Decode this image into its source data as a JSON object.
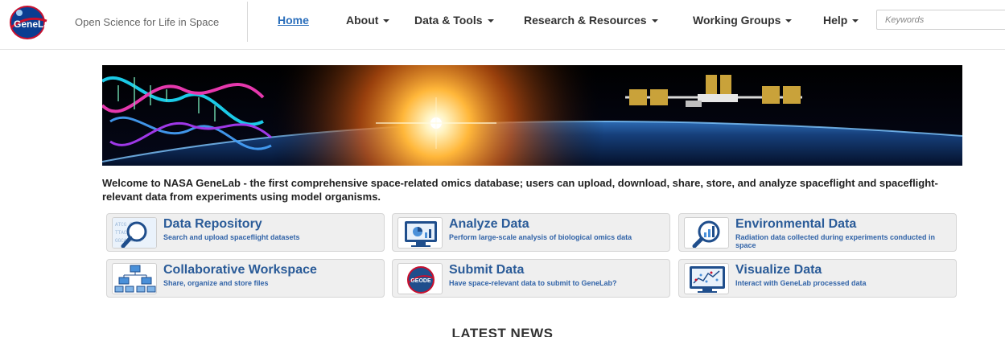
{
  "header": {
    "logo_text": "GeneLab",
    "tagline": "Open Science for Life in Space",
    "nav": [
      {
        "label": "Home"
      },
      {
        "label": "About"
      },
      {
        "label": "Data & Tools"
      },
      {
        "label": "Research & Resources"
      },
      {
        "label": "Working Groups"
      },
      {
        "label": "Help"
      }
    ],
    "search": {
      "placeholder": "Keywords",
      "value": ""
    }
  },
  "welcome_text": "Welcome to NASA GeneLab - the first comprehensive space-related omics database; users can upload, download, share, store, and analyze spaceflight and spaceflight-relevant data from experiments using model organisms.",
  "cards": [
    {
      "title": "Data Repository",
      "desc": "Search and upload spaceflight datasets",
      "icon": "magnifier-icon"
    },
    {
      "title": "Analyze Data",
      "desc": "Perform large-scale analysis of biological omics data",
      "icon": "monitor-chart-icon"
    },
    {
      "title": "Environmental Data",
      "desc": "Radiation data collected during experiments conducted in space",
      "icon": "magnifier-chart-icon"
    },
    {
      "title": "Collaborative Workspace",
      "desc": "Share, organize and store files",
      "icon": "network-tree-icon"
    },
    {
      "title": "Submit Data",
      "desc": "Have space-relevant data to submit to GeneLab?",
      "icon": "geode-icon"
    },
    {
      "title": "Visualize Data",
      "desc": "Interact with GeneLab processed data",
      "icon": "scatter-monitor-icon"
    }
  ],
  "news_heading": "LATEST NEWS",
  "colors": {
    "accent": "#2a6ebb",
    "card_title": "#2a5b98",
    "card_bg": "#efefef"
  }
}
